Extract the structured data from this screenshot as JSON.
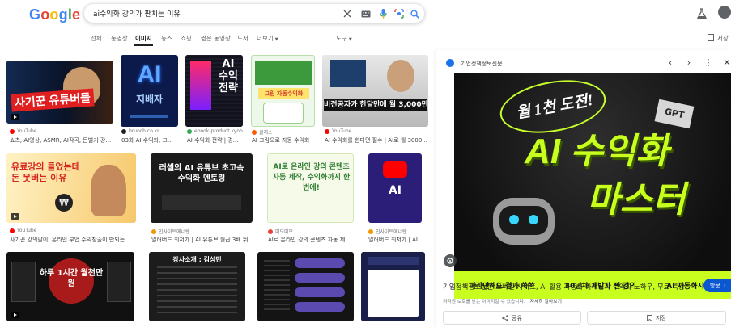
{
  "header": {
    "logo": [
      "G",
      "o",
      "o",
      "g",
      "l",
      "e"
    ],
    "logo_colors": [
      "#4285F4",
      "#EA4335",
      "#FBBC05",
      "#4285F4",
      "#34A853",
      "#EA4335"
    ],
    "search_value": "ai수익화 강의가 판치는 이유",
    "icons": [
      "close-icon",
      "keyboard-icon",
      "mic-icon",
      "lens-icon",
      "search-icon",
      "labs-icon"
    ]
  },
  "tabs": [
    {
      "label": "전체",
      "active": false
    },
    {
      "label": "동영상",
      "active": false
    },
    {
      "label": "이미지",
      "active": true
    },
    {
      "label": "뉴스",
      "active": false
    },
    {
      "label": "쇼핑",
      "active": false
    },
    {
      "label": "짧은 동영상",
      "active": false
    },
    {
      "label": "도서",
      "active": false
    },
    {
      "label": "더보기",
      "active": false
    }
  ],
  "tools_label": "도구",
  "saved_label": "저장",
  "results": [
    {
      "source": "YouTube",
      "title": "쇼츠, AI영상, ASMR, AI작곡, 돈벌기 강의...",
      "thumb_text": "사기꾼 유튜버들",
      "src_color": "#ff0000",
      "video": true
    },
    {
      "source": "brunch.co.kr",
      "title": "03화 AI 수익화, 그...",
      "thumb_text": "AI 지배자",
      "src_color": "#202124",
      "video": false
    },
    {
      "source": "ebook-product.kyob...",
      "title": "AI 수익화 전략 | 경...",
      "thumb_text": "AI 수익화 전략",
      "src_color": "#34a853",
      "video": false
    },
    {
      "source": "클래스",
      "title": "AI 그림으로 자동 수익화",
      "thumb_text": "그림 자동수익화",
      "src_color": "#ff5a00",
      "video": false
    },
    {
      "source": "YouTube",
      "title": "AI 수익화를 한다면 필수 | AI로 월 3000...",
      "thumb_text": "비전공자가 한달만에 월 3,000만원 만든 방법",
      "src_color": "#ff0000",
      "video": true
    },
    {
      "source": "YouTube",
      "title": "사기꾼 강의팔이, 온라인 부업 수익창출이 만되는 이유",
      "thumb_text": "유료강의 들었는데 돈 못버는 이유",
      "src_color": "#ff0000",
      "video": true
    },
    {
      "source": "인사이트에너텐",
      "title": "얼러버드 최저가 | AI 유튜브 월급 3배 뛰...",
      "thumb_text": "러셀의 AI 유튜브 초고속 수익화 멘토링",
      "src_color": "#f29900",
      "video": false
    },
    {
      "source": "미모미모",
      "title": "AI로 온라인 강의 콘텐츠 자동 제작, 수...",
      "thumb_text": "AI로 온라인 강의 콘텐츠 자동 제작, 수익화까지 한 번에!",
      "src_color": "#ea4335",
      "video": false
    },
    {
      "source": "인사이트에너텐",
      "title": "얼러버드 최저가 | AI 유...",
      "thumb_text": "AI",
      "src_color": "#f29900",
      "video": false
    },
    {
      "thumb_text": "하루 1시간 월천만원",
      "video": true
    },
    {
      "thumb_text": "강사소개 : 김성민",
      "video": false
    },
    {
      "thumb_text": "",
      "video": false
    },
    {
      "thumb_text": "",
      "video": false
    }
  ],
  "panel": {
    "source": "기업정책정보신문",
    "title": "기업정책정보신문 모바일 사이트, AI 활용 자동화 마케팅과 수익화 노하우, 무료 특강",
    "visit_label": "방문",
    "note": "저작권 보호를 받는 이미지일 수 있습니다.",
    "note_link": "자세히 알아보기",
    "share_label": "공유",
    "save_label": "저장",
    "image": {
      "headline": "월 1천 도전!",
      "badge": "GPT",
      "main_line1": "AI 수익화",
      "main_line2": "마스터",
      "footer": [
        "따라만해도 결과 쑥쑥",
        "30년차 개발자 찐 강의",
        "AI 자동화시스템"
      ]
    }
  }
}
